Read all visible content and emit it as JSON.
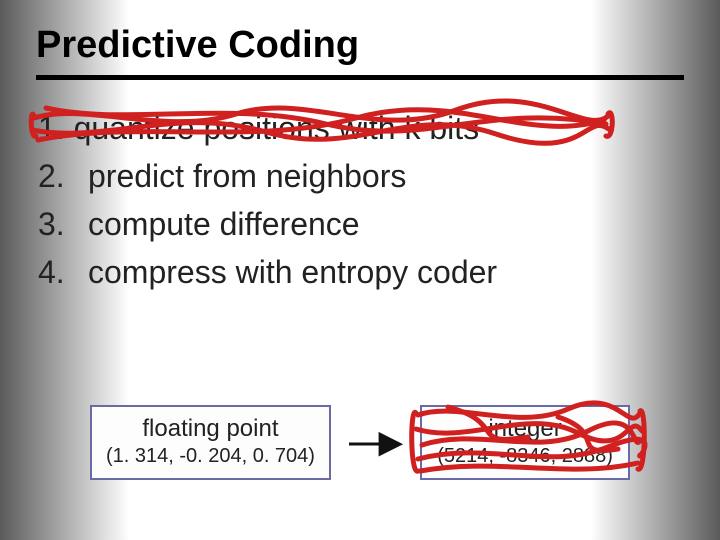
{
  "title": "Predictive Coding",
  "list": {
    "items": [
      {
        "num": "1.",
        "text": "quantize positions with k bits",
        "struck": true
      },
      {
        "num": "2.",
        "text": "predict from neighbors",
        "struck": false
      },
      {
        "num": "3.",
        "text": "compute difference",
        "struck": false
      },
      {
        "num": "4.",
        "text": "compress with entropy coder",
        "struck": false
      }
    ]
  },
  "boxes": {
    "left": {
      "title": "floating point",
      "value": "(1. 314,  -0. 204,  0. 704)",
      "struck": false
    },
    "right": {
      "title": "integer",
      "value": "(5214, -8346, 2888)",
      "struck": true
    }
  },
  "arrow_glyph": "—▶",
  "colors": {
    "scribble": "#d02020"
  }
}
